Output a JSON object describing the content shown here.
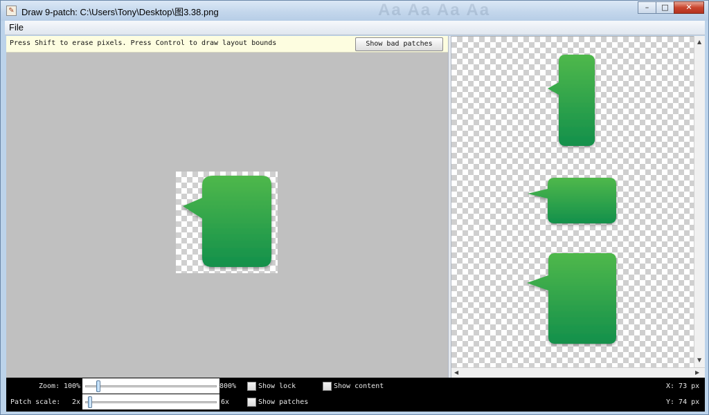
{
  "window": {
    "title": "Draw 9-patch: C:\\Users\\Tony\\Desktop\\图3.38.png",
    "minimize_icon": "minimize-icon",
    "maximize_icon": "maximize-icon",
    "close_icon": "close-icon"
  },
  "menu": {
    "file": "File"
  },
  "editor": {
    "hint": "Press Shift to erase pixels. Press Control to draw layout bounds",
    "show_bad_patches": "Show bad patches"
  },
  "status": {
    "zoom_label": "Zoom:",
    "zoom_min": "100%",
    "zoom_max": "800%",
    "zoom_value_fraction": 0.06,
    "patch_scale_label": "Patch scale:",
    "patch_min": "2x",
    "patch_max": "6x",
    "patch_value_fraction": 0.0,
    "show_lock": "Show lock",
    "show_content": "Show content",
    "show_patches": "Show patches",
    "x_readout": "X: 73 px",
    "y_readout": "Y: 74 px"
  },
  "colors": {
    "bubble_top": "#4fb84c",
    "bubble_bottom": "#13904c",
    "editor_bg": "#c0c0c0",
    "hint_bg": "#fdfde0"
  }
}
